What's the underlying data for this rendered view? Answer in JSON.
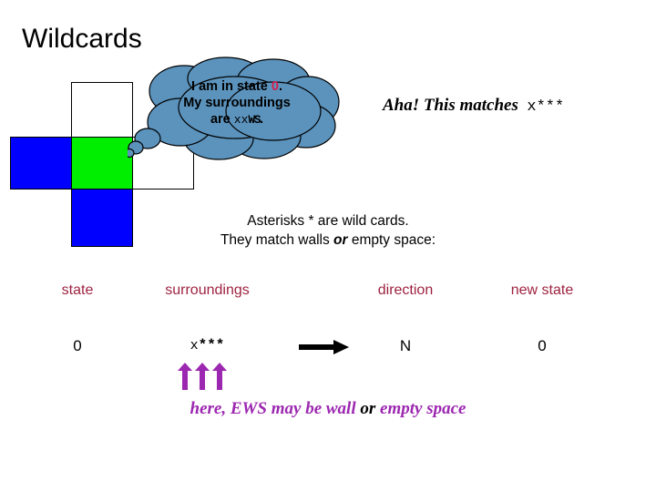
{
  "slide": {
    "title": "Wildcards",
    "background_color": "#ffffff"
  },
  "maze": {
    "cells": [
      {
        "name": "north",
        "fill": "#ffffff",
        "label": "empty space above"
      },
      {
        "name": "west",
        "fill": "#0000ff",
        "label": "wall to the west"
      },
      {
        "name": "center",
        "fill": "#00ee00",
        "label": "robot current cell"
      },
      {
        "name": "east",
        "fill": "#ffffff",
        "label": "empty space east"
      },
      {
        "name": "south",
        "fill": "#0000ff",
        "label": "wall to the south"
      }
    ]
  },
  "thought_bubble": {
    "fill": "#5b93bd",
    "stroke": "#000000",
    "line1_prefix": "I am in state ",
    "state_value": "0",
    "line1_suffix": ".",
    "line2": "My surroundings",
    "line3_prefix": "are ",
    "line3_x": "xx",
    "line3_ws": "WS",
    "line3_suffix": "."
  },
  "aha": {
    "text": "Aha! This matches",
    "pattern": "x***"
  },
  "asterisk_note": {
    "line1_before": "Asterisks ",
    "line1_symbol": "*",
    "line1_after": " are wild cards.",
    "line2_before": "They match walls ",
    "line2_emphasis": "or",
    "line2_after": " empty space:"
  },
  "rule_table": {
    "headers": {
      "state": "state",
      "surroundings": "surroundings",
      "direction": "direction",
      "new_state": "new state"
    },
    "header_color": "#9e2240",
    "row": {
      "state": "0",
      "surroundings_literal": "x",
      "surroundings_wildcards": "***",
      "direction_icon": "right-arrow-icon",
      "direction": "N",
      "new_state": "0"
    }
  },
  "wildcard_pointers": {
    "icon": "up-arrow-icon",
    "count": 3,
    "color": "#9c27b0"
  },
  "wildcard_caption": {
    "before": "here, EWS may be wall ",
    "emphasis": "or",
    "after": " empty space",
    "color": "#9c27b0"
  }
}
